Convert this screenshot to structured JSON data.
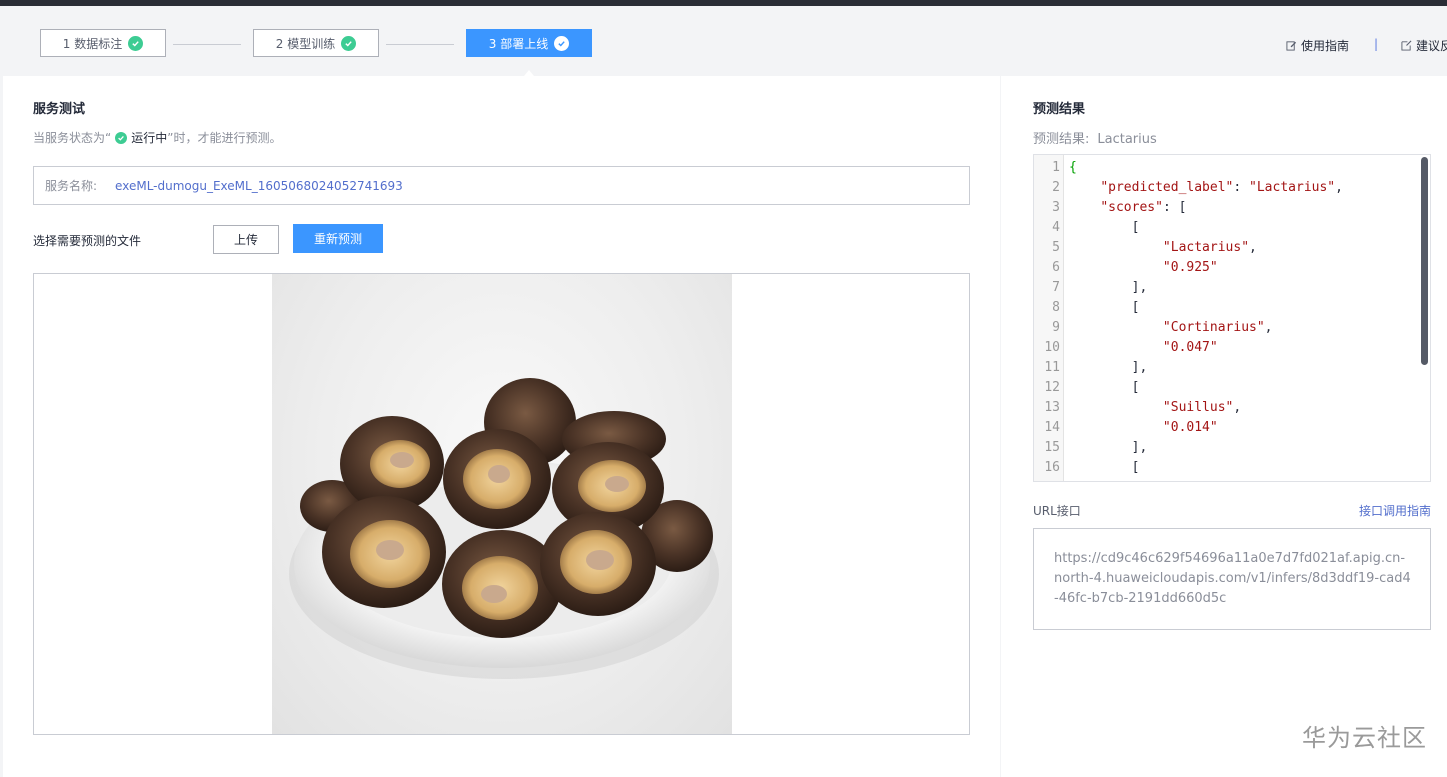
{
  "steps": [
    {
      "label": "1 数据标注"
    },
    {
      "label": "2 模型训练"
    },
    {
      "label": "3 部署上线"
    }
  ],
  "top_links": {
    "guide": "使用指南",
    "separator": "|",
    "feedback": "建议反"
  },
  "service_test": {
    "title": "服务测试",
    "hint_prefix": "当服务状态为“",
    "hint_status": "运行中",
    "hint_suffix": "”时，才能进行预测。",
    "service_name_label": "服务名称:",
    "service_name_value": "exeML-dumogu_ExeML_1605068024052741693",
    "file_label": "选择需要预测的文件",
    "upload_button": "上传",
    "repredict_button": "重新预测"
  },
  "prediction": {
    "title": "预测结果",
    "result_label": "预测结果:",
    "result_value": "Lactarius",
    "json_lines": [
      "{",
      "    \"predicted_label\": \"Lactarius\",",
      "    \"scores\": [",
      "        [",
      "            \"Lactarius\",",
      "            \"0.925\"",
      "        ],",
      "        [",
      "            \"Cortinarius\",",
      "            \"0.047\"",
      "        ],",
      "        [",
      "            \"Suillus\",",
      "            \"0.014\"",
      "        ],",
      "        ["
    ]
  },
  "url_api": {
    "label": "URL接口",
    "link": "接口调用指南",
    "value": "https://cd9c46c629f54696a11a0e7d7fd021af.apig.cn-north-4.huaweicloudapis.com/v1/infers/8d3ddf19-cad4-46fc-b7cb-2191dd660d5c"
  },
  "watermark": "华为云社区",
  "colors": {
    "primary": "#3b96ff",
    "success": "#3dcc93",
    "link": "#526ecc"
  }
}
